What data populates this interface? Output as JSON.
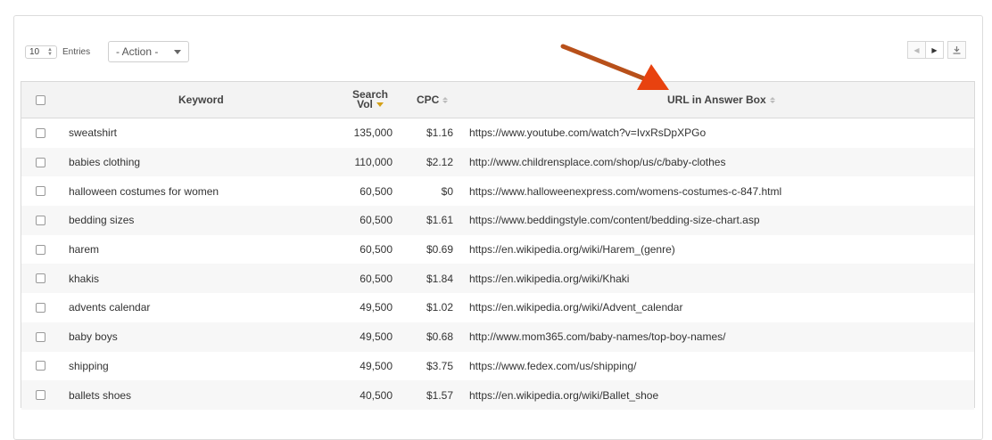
{
  "toolbar": {
    "entries_value": "10",
    "entries_label": "Entries",
    "action_label": "- Action -",
    "pager_prev": "‹",
    "pager_next": "›",
    "download_icon": "download-icon"
  },
  "table": {
    "columns": {
      "keyword": "Keyword",
      "search_vol_line1": "Search",
      "search_vol_line2": "Vol",
      "cpc": "CPC",
      "url": "URL in Answer Box"
    },
    "rows": [
      {
        "keyword": "sweatshirt",
        "vol": "135,000",
        "cpc": "$1.16",
        "url": "https://www.youtube.com/watch?v=IvxRsDpXPGo"
      },
      {
        "keyword": "babies clothing",
        "vol": "110,000",
        "cpc": "$2.12",
        "url": "http://www.childrensplace.com/shop/us/c/baby-clothes"
      },
      {
        "keyword": "halloween costumes for women",
        "vol": "60,500",
        "cpc": "$0",
        "url": "https://www.halloweenexpress.com/womens-costumes-c-847.html"
      },
      {
        "keyword": "bedding sizes",
        "vol": "60,500",
        "cpc": "$1.61",
        "url": "https://www.beddingstyle.com/content/bedding-size-chart.asp"
      },
      {
        "keyword": "harem",
        "vol": "60,500",
        "cpc": "$0.69",
        "url": "https://en.wikipedia.org/wiki/Harem_(genre)"
      },
      {
        "keyword": "khakis",
        "vol": "60,500",
        "cpc": "$1.84",
        "url": "https://en.wikipedia.org/wiki/Khaki"
      },
      {
        "keyword": "advents calendar",
        "vol": "49,500",
        "cpc": "$1.02",
        "url": "https://en.wikipedia.org/wiki/Advent_calendar"
      },
      {
        "keyword": "baby boys",
        "vol": "49,500",
        "cpc": "$0.68",
        "url": "http://www.mom365.com/baby-names/top-boy-names/"
      },
      {
        "keyword": "shipping",
        "vol": "49,500",
        "cpc": "$3.75",
        "url": "https://www.fedex.com/us/shipping/"
      },
      {
        "keyword": "ballets shoes",
        "vol": "40,500",
        "cpc": "$1.57",
        "url": "https://en.wikipedia.org/wiki/Ballet_shoe"
      }
    ]
  },
  "colors": {
    "arrow": "#e8420f",
    "sort_active": "#d4a017"
  }
}
